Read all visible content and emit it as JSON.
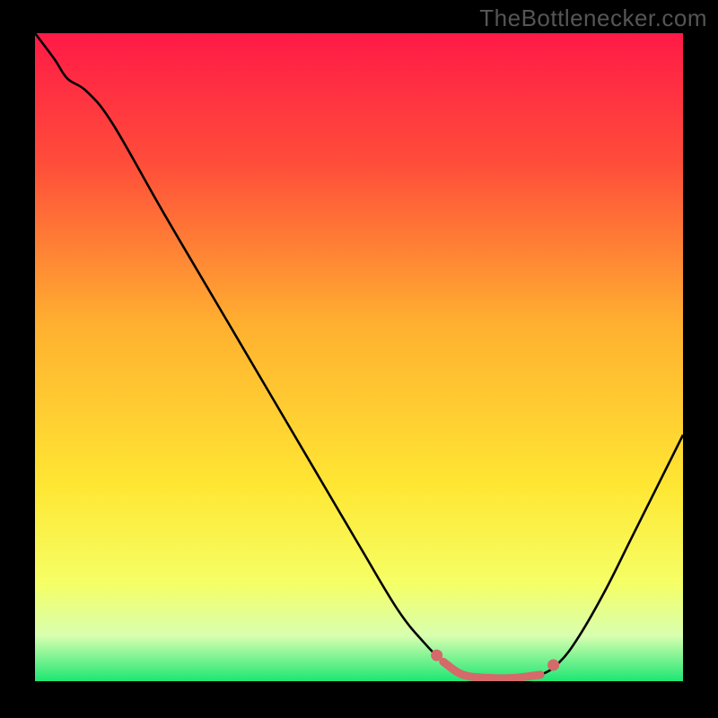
{
  "watermark": "TheBottleneсker.com",
  "chart_data": {
    "type": "line",
    "title": "",
    "xlabel": "",
    "ylabel": "",
    "xlim": [
      0,
      100
    ],
    "ylim": [
      0,
      100
    ],
    "gradient_stops": [
      {
        "offset": 0,
        "color": "#ff1a47"
      },
      {
        "offset": 20,
        "color": "#ff4d3a"
      },
      {
        "offset": 45,
        "color": "#ffb030"
      },
      {
        "offset": 70,
        "color": "#ffe733"
      },
      {
        "offset": 85,
        "color": "#f5ff66"
      },
      {
        "offset": 93,
        "color": "#d8ffb0"
      },
      {
        "offset": 100,
        "color": "#1de673"
      }
    ],
    "curve": [
      {
        "x": 0,
        "y": 100
      },
      {
        "x": 3,
        "y": 96
      },
      {
        "x": 5,
        "y": 93
      },
      {
        "x": 8,
        "y": 91
      },
      {
        "x": 12,
        "y": 86
      },
      {
        "x": 20,
        "y": 72
      },
      {
        "x": 30,
        "y": 55
      },
      {
        "x": 40,
        "y": 38
      },
      {
        "x": 50,
        "y": 21
      },
      {
        "x": 56,
        "y": 11
      },
      {
        "x": 60,
        "y": 6
      },
      {
        "x": 63,
        "y": 3
      },
      {
        "x": 66,
        "y": 1
      },
      {
        "x": 70,
        "y": 0.5
      },
      {
        "x": 74,
        "y": 0.5
      },
      {
        "x": 78,
        "y": 1
      },
      {
        "x": 81,
        "y": 3
      },
      {
        "x": 84,
        "y": 7
      },
      {
        "x": 88,
        "y": 14
      },
      {
        "x": 92,
        "y": 22
      },
      {
        "x": 96,
        "y": 30
      },
      {
        "x": 100,
        "y": 38
      }
    ],
    "highlight_band": {
      "x_start": 62,
      "x_end": 80,
      "color": "#d46a6a",
      "width": 9
    },
    "highlight_dots": [
      {
        "x": 62,
        "y": 4
      },
      {
        "x": 80,
        "y": 2.5
      }
    ]
  }
}
